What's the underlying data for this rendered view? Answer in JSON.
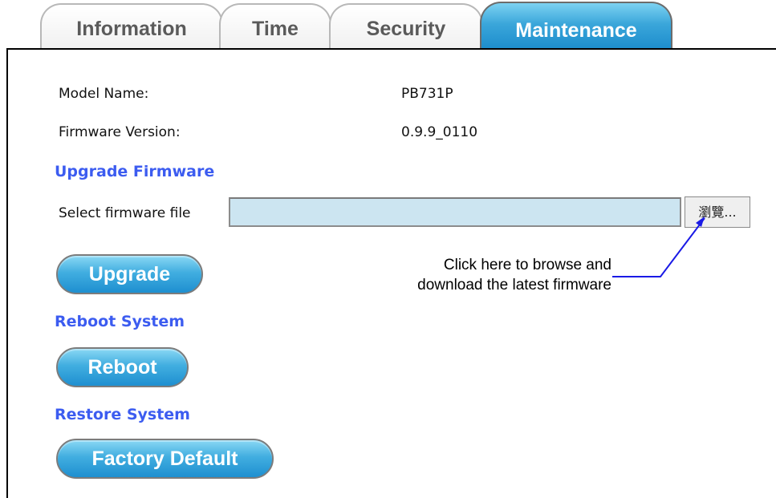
{
  "tabs": [
    {
      "label": "Information",
      "active": false
    },
    {
      "label": "Time",
      "active": false
    },
    {
      "label": "Security",
      "active": false
    },
    {
      "label": "Maintenance",
      "active": true
    }
  ],
  "info": {
    "model_label": "Model Name:",
    "model_value": "PB731P",
    "firmware_label": "Firmware Version:",
    "firmware_value": "0.9.9_0110"
  },
  "upgrade": {
    "heading": "Upgrade Firmware",
    "select_label": "Select firmware file",
    "file_value": "",
    "browse_label": "瀏覽...",
    "button_label": "Upgrade"
  },
  "reboot": {
    "heading": "Reboot System",
    "button_label": "Reboot"
  },
  "restore": {
    "heading": "Restore System",
    "button_label": "Factory Default"
  },
  "annotation": {
    "line1": "Click here to browse and",
    "line2": "download the latest firmware"
  },
  "colors": {
    "section_heading": "#3c5cf0",
    "active_tab": "#3aa6da",
    "file_input_bg": "#cce5f1",
    "callout_line": "#1a1ae6"
  }
}
